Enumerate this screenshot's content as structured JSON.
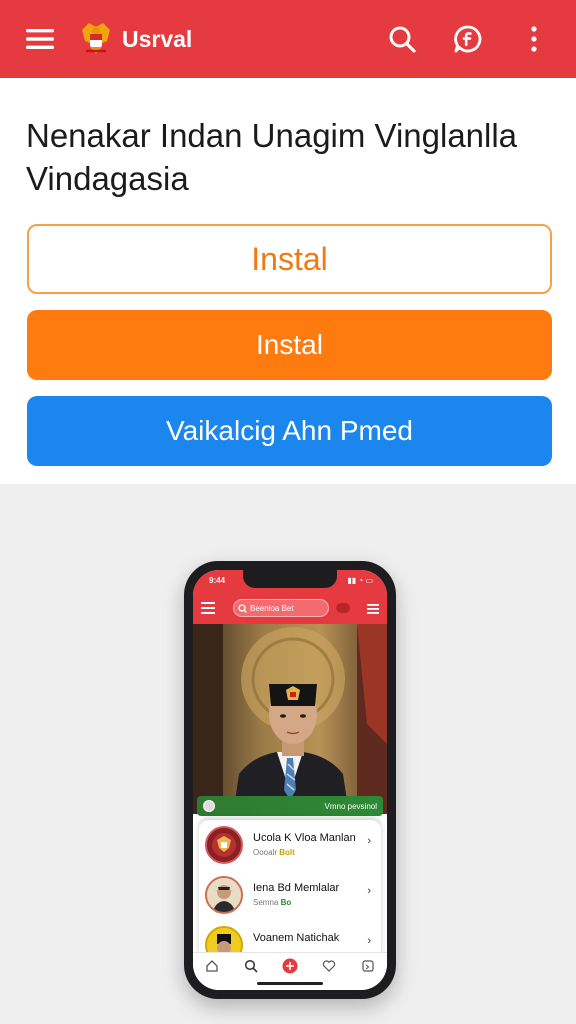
{
  "app_bar": {
    "title": "Usrval",
    "icons": [
      "menu-icon",
      "garuda-logo",
      "search-icon",
      "chat-icon",
      "more-icon"
    ],
    "color": "#e53a3f"
  },
  "card": {
    "headline": "Nenakar Indan Unagim Vinglanlla Vindagasia",
    "buttons": [
      {
        "label": "Instal",
        "style": "outline",
        "color": "#f07a12"
      },
      {
        "label": "Instal",
        "style": "filled",
        "color": "#ff7a0f"
      },
      {
        "label": "Vaikalcig Ahn Pmed",
        "style": "filled",
        "color": "#1c86ef"
      }
    ]
  },
  "phone": {
    "status_time": "9:44",
    "search_placeholder": "Beenloa Bet",
    "caption_right": "Vmno pevsinol",
    "list": [
      {
        "name": "Ucola K Vloa Manlan",
        "sub": "Oooalr",
        "tag": "Bolt"
      },
      {
        "name": "Iena Bd Memlalar",
        "sub": "Semna",
        "tag": "Bo"
      },
      {
        "name": "Voanem Natichak",
        "sub": "",
        "tag": ""
      }
    ],
    "nav_icons": [
      "home-icon",
      "search-icon",
      "add-icon",
      "heart-icon",
      "message-icon"
    ]
  }
}
